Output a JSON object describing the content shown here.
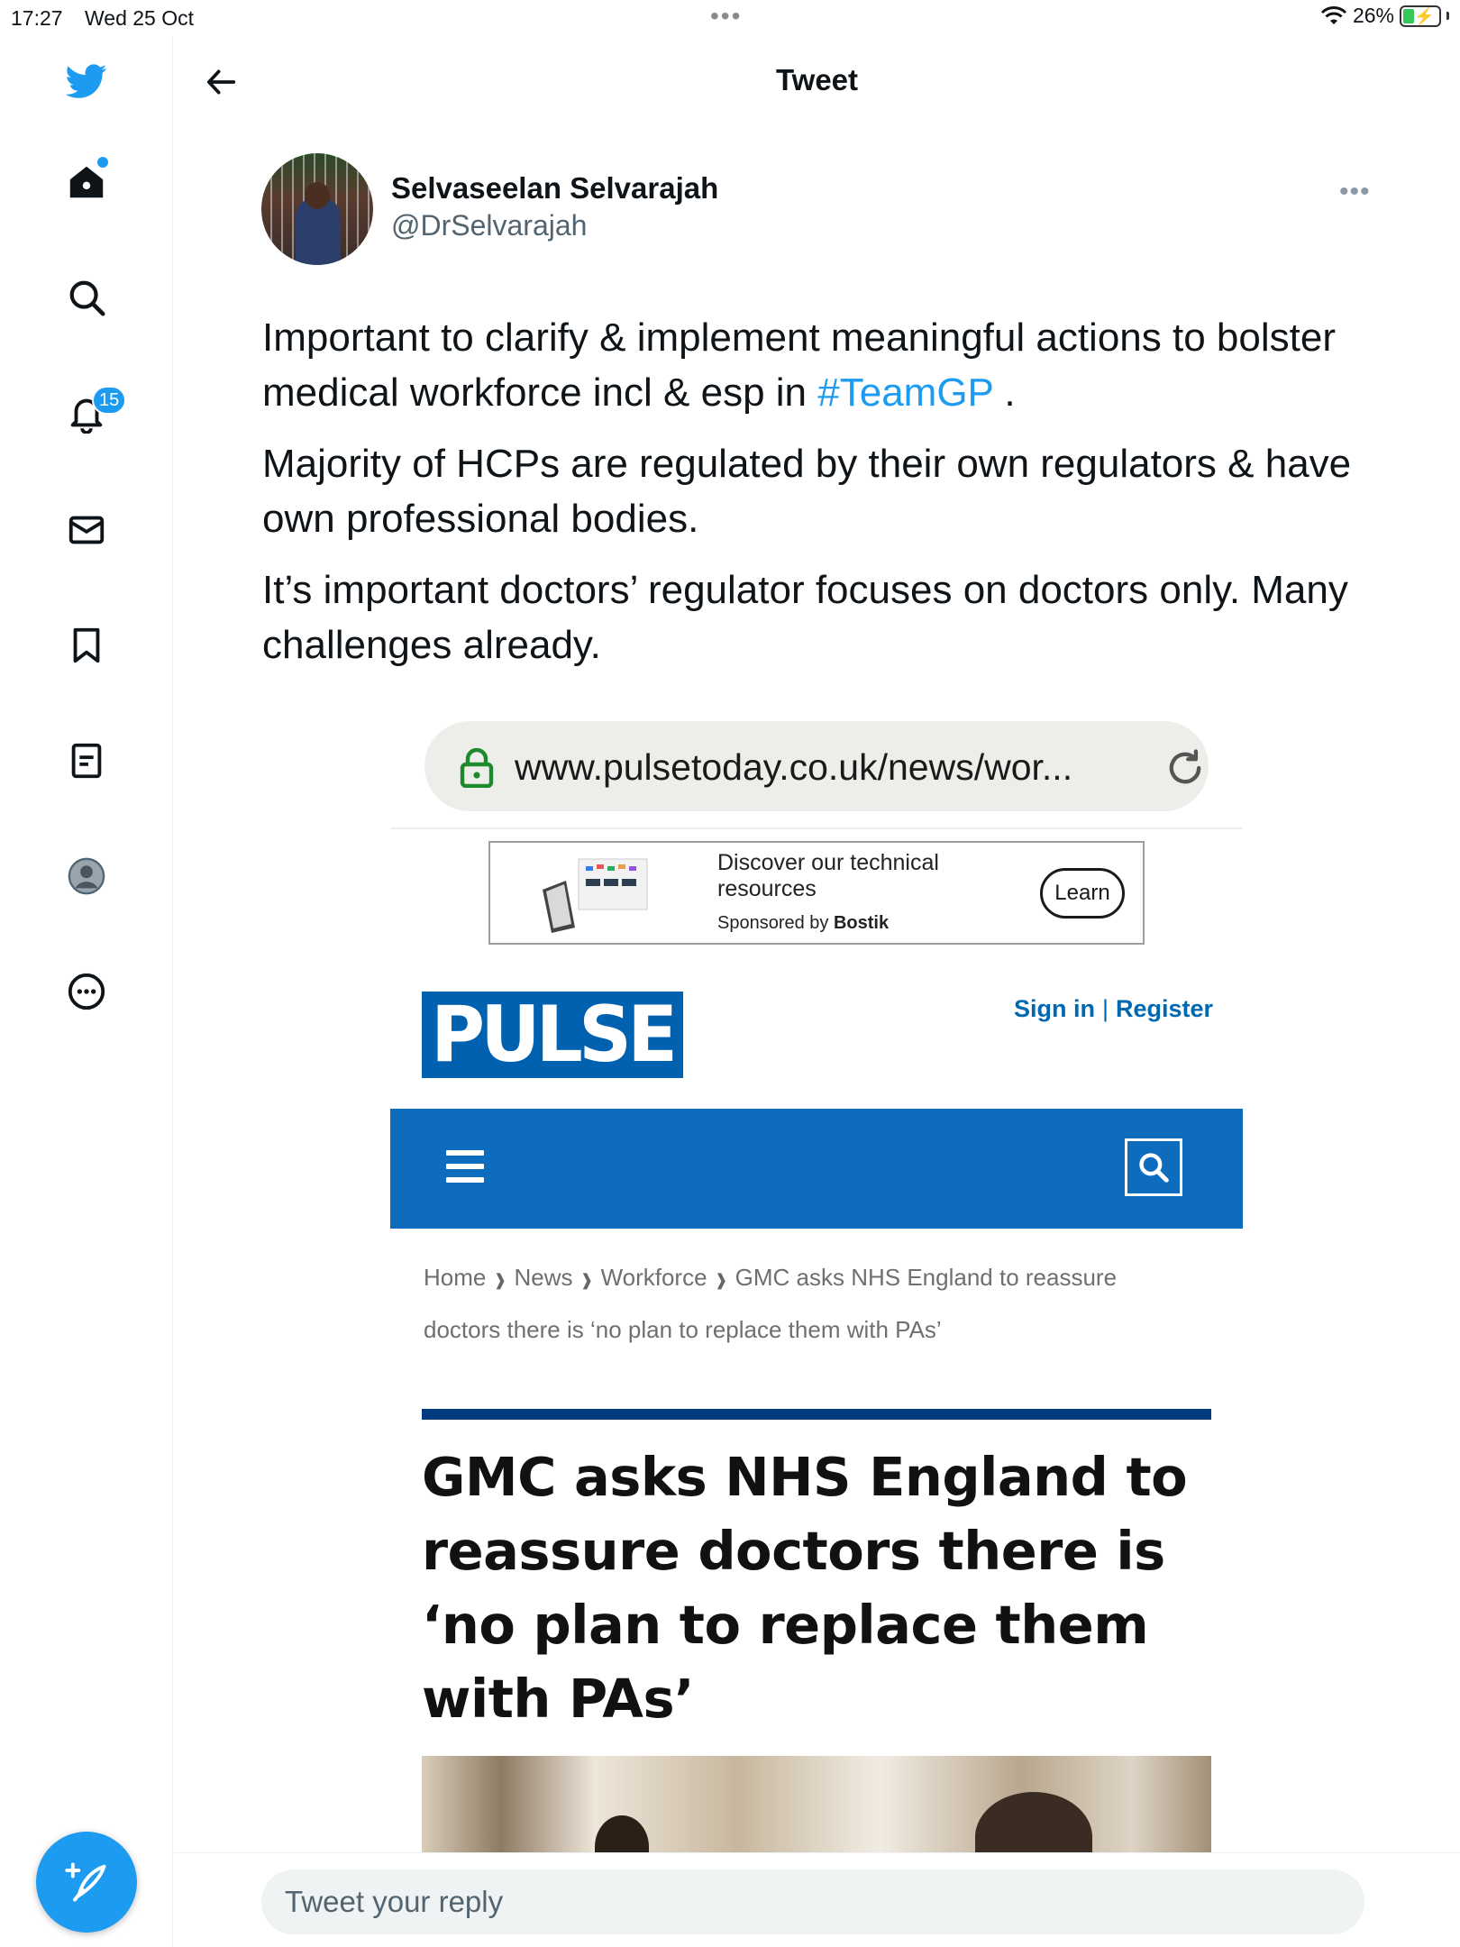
{
  "status_bar": {
    "time": "17:27",
    "date": "Wed 25 Oct",
    "battery": "26%"
  },
  "sidebar": {
    "items": [
      {
        "name": "twitter-logo-icon"
      },
      {
        "name": "home-icon"
      },
      {
        "name": "search-icon"
      },
      {
        "name": "notifications-icon",
        "badge": "15"
      },
      {
        "name": "messages-icon"
      },
      {
        "name": "bookmarks-icon"
      },
      {
        "name": "lists-icon"
      },
      {
        "name": "profile-icon"
      },
      {
        "name": "more-icon"
      }
    ],
    "accent": "#1d9bf0"
  },
  "header": {
    "title": "Tweet"
  },
  "tweet": {
    "author_name": "Selvaseelan Selvarajah",
    "author_handle": "@DrSelvarajah",
    "para1_text": "Important to clarify & implement meaningful actions to bolster medical workforce incl & esp in ",
    "para1_hashtag": "#TeamGP",
    "para1_end": " .",
    "para2": "Majority of HCPs are regulated by their own regulators & have own professional bodies.",
    "para3": "It’s important doctors’ regulator focuses on doctors only. Many challenges already."
  },
  "embedded_image": {
    "url": "www.pulsetoday.co.uk/news/wor...",
    "ad": {
      "headline": "Discover our technical resources",
      "sponsored_prefix": "Sponsored by ",
      "sponsor": "Bostik",
      "button": "Learn"
    },
    "logo_text": "PULSE",
    "sign_in": "Sign in",
    "register": "Register",
    "auth_separator": "|",
    "breadcrumbs": [
      "Home",
      "News",
      "Workforce",
      "GMC asks NHS England to reassure doctors there is ‘no plan to replace them with PAs’"
    ],
    "article_title": "GMC asks NHS England to reassure doctors there is ‘no plan to replace them with PAs’",
    "brand_blue": "#0e6cbf"
  },
  "reply": {
    "placeholder": "Tweet your reply"
  }
}
